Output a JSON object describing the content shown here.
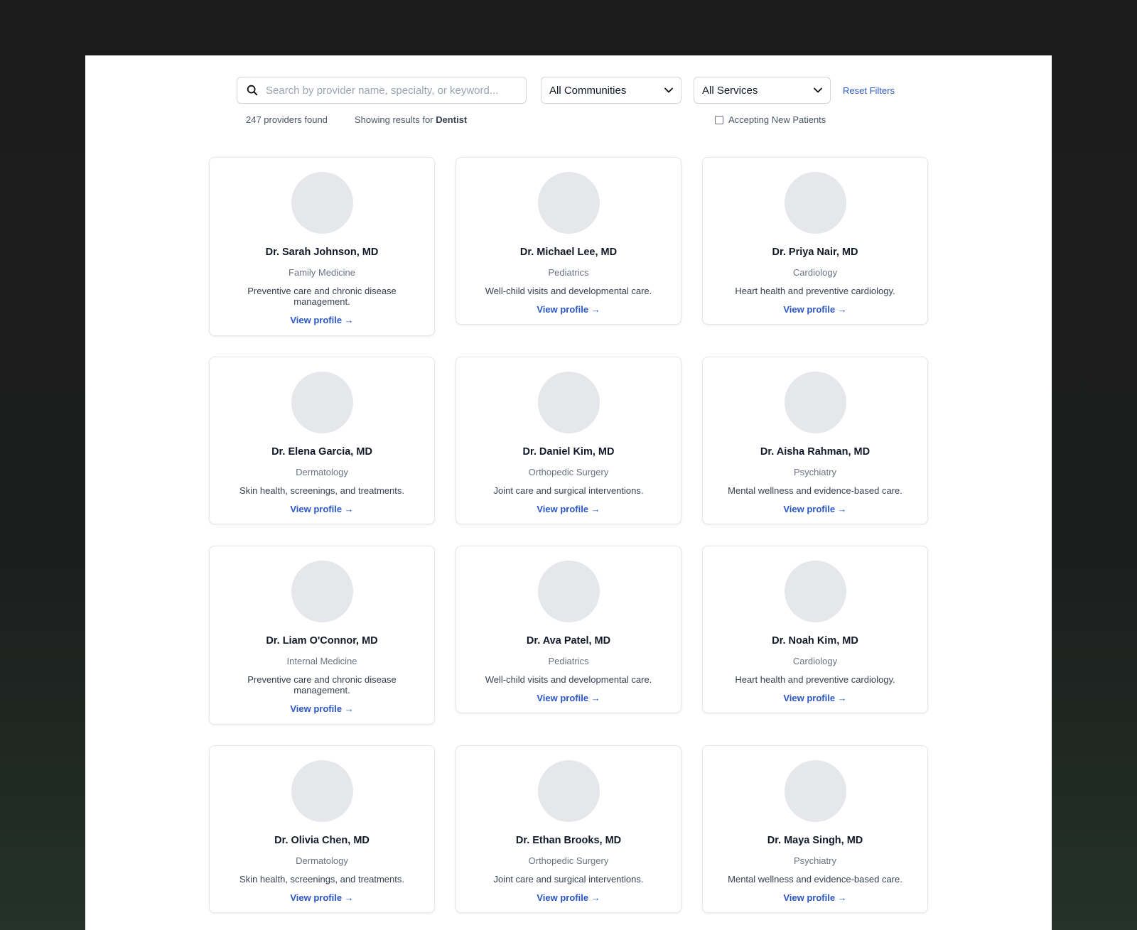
{
  "search": {
    "placeholder": "Search by provider name, specialty, or keyword..."
  },
  "filters": {
    "community": "All Communities",
    "service": "All Services",
    "reset_label": "Reset Filters",
    "accepting_label": "Accepting New Patients",
    "accepting_checked": false
  },
  "results": {
    "count_text": "247 providers found",
    "showing_prefix": "Showing results for",
    "showing_term": "Dentist"
  },
  "providers": [
    {
      "name": "Dr. Sarah Johnson, MD",
      "specialty": "Family Medicine",
      "description": "Preventive care and chronic disease management.",
      "link": "View profile →"
    },
    {
      "name": "Dr. Michael Lee, MD",
      "specialty": "Pediatrics",
      "description": "Well-child visits and developmental care.",
      "link": "View profile →"
    },
    {
      "name": "Dr. Priya Nair, MD",
      "specialty": "Cardiology",
      "description": "Heart health and preventive cardiology.",
      "link": "View profile →"
    },
    {
      "name": "Dr. Elena Garcia, MD",
      "specialty": "Dermatology",
      "description": "Skin health, screenings, and treatments.",
      "link": "View profile →"
    },
    {
      "name": "Dr. Daniel Kim, MD",
      "specialty": "Orthopedic Surgery",
      "description": "Joint care and surgical interventions.",
      "link": "View profile →"
    },
    {
      "name": "Dr. Aisha Rahman, MD",
      "specialty": "Psychiatry",
      "description": "Mental wellness and evidence-based care.",
      "link": "View profile →"
    },
    {
      "name": "Dr. Liam O'Connor, MD",
      "specialty": "Internal Medicine",
      "description": "Preventive care and chronic disease management.",
      "link": "View profile →"
    },
    {
      "name": "Dr. Ava Patel, MD",
      "specialty": "Pediatrics",
      "description": "Well-child visits and developmental care.",
      "link": "View profile →"
    },
    {
      "name": "Dr. Noah Kim, MD",
      "specialty": "Cardiology",
      "description": "Heart health and preventive cardiology.",
      "link": "View profile →"
    },
    {
      "name": "Dr. Olivia Chen, MD",
      "specialty": "Dermatology",
      "description": "Skin health, screenings, and treatments.",
      "link": "View profile →"
    },
    {
      "name": "Dr. Ethan Brooks, MD",
      "specialty": "Orthopedic Surgery",
      "description": "Joint care and surgical interventions.",
      "link": "View profile →"
    },
    {
      "name": "Dr. Maya Singh, MD",
      "specialty": "Psychiatry",
      "description": "Mental wellness and evidence-based care.",
      "link": "View profile →"
    }
  ],
  "colors": {
    "link": "#2b57c5",
    "avatar_placeholder": "#e5e7eb",
    "page_background": "#1c1c1c"
  },
  "icons": {
    "search": "search-icon",
    "dropdown": "chevron-down-icon"
  }
}
